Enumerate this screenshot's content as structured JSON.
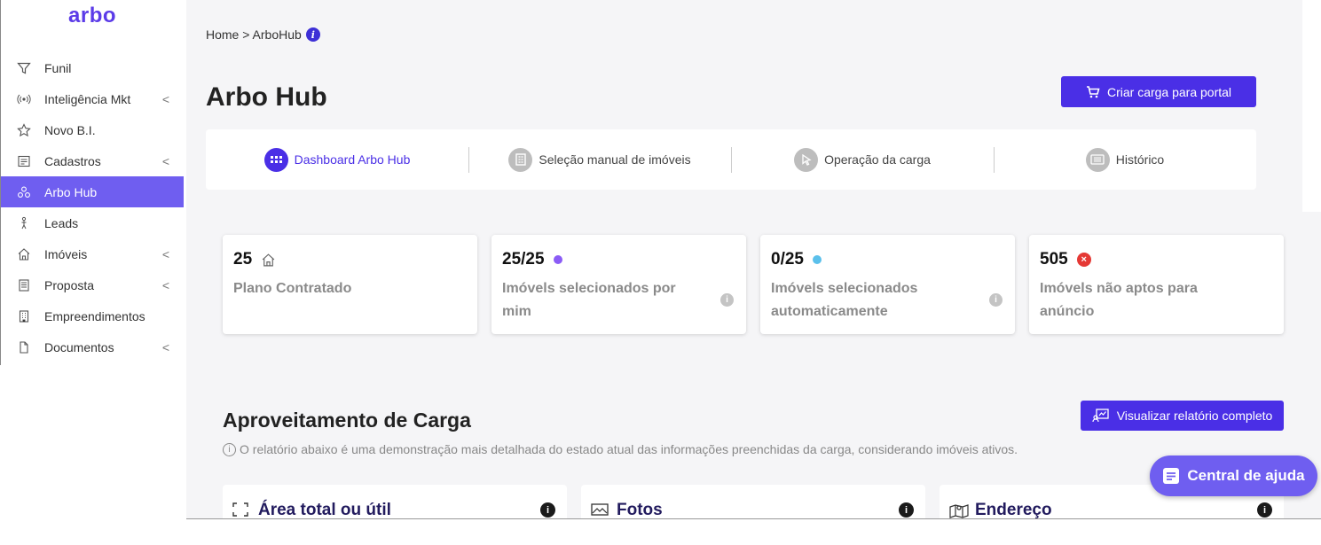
{
  "app": {
    "logo": "arbo"
  },
  "sidebar": {
    "items": [
      {
        "label": "Funil",
        "icon": "filter-icon",
        "chevron": false,
        "active": false
      },
      {
        "label": "Inteligência Mkt",
        "icon": "broadcast-icon",
        "chevron": true,
        "active": false
      },
      {
        "label": "Novo B.I.",
        "icon": "star-icon",
        "chevron": false,
        "active": false
      },
      {
        "label": "Cadastros",
        "icon": "register-icon",
        "chevron": true,
        "active": false
      },
      {
        "label": "Arbo Hub",
        "icon": "hub-icon",
        "chevron": false,
        "active": true
      },
      {
        "label": "Leads",
        "icon": "person-icon",
        "chevron": false,
        "active": false
      },
      {
        "label": "Imóveis",
        "icon": "house-icon",
        "chevron": true,
        "active": false
      },
      {
        "label": "Proposta",
        "icon": "document-icon",
        "chevron": true,
        "active": false
      },
      {
        "label": "Empreendimentos",
        "icon": "building-icon",
        "chevron": false,
        "active": false
      },
      {
        "label": "Documentos",
        "icon": "file-icon",
        "chevron": true,
        "active": false
      }
    ],
    "chevron_glyph": "<"
  },
  "breadcrumb": {
    "text": "Home > ArboHub",
    "info_glyph": "i"
  },
  "page": {
    "title": "Arbo Hub"
  },
  "toolbar": {
    "create_load_label": "Criar carga para portal"
  },
  "tabs": [
    {
      "label": "Dashboard Arbo Hub",
      "icon": "dashboard-icon",
      "active": true
    },
    {
      "label": "Seleção manual de imóveis",
      "icon": "selection-icon",
      "active": false
    },
    {
      "label": "Operação da carga",
      "icon": "cursor-icon",
      "active": false
    },
    {
      "label": "Histórico",
      "icon": "history-icon",
      "active": false
    }
  ],
  "stats": [
    {
      "value": "25",
      "label": "Plano Contratado",
      "marker": "house-icon",
      "info": false
    },
    {
      "value": "25/25",
      "label": "Imóvels selecionados por mim",
      "marker": "purple-dot",
      "marker_color": "#8b5cf6",
      "info": true
    },
    {
      "value": "0/25",
      "label": "Imóvels selecionados automaticamente",
      "marker": "blue-dot",
      "marker_color": "#5bc0eb",
      "info": true
    },
    {
      "value": "505",
      "label": "Imóvels não aptos para anúncio",
      "marker": "error-icon",
      "marker_color": "#e53935",
      "info": false
    }
  ],
  "report_section": {
    "title": "Aproveitamento de Carga",
    "description": "O relatório abaixo é uma demonstração mais detalhada do estado atual das informações preenchidas da carga, considerando imóveis ativos.",
    "button_label": "Visualizar relatório completo"
  },
  "cards": [
    {
      "title": "Área total ou útil",
      "icon": "expand-icon"
    },
    {
      "title": "Fotos",
      "icon": "photo-icon"
    },
    {
      "title": "Endereço",
      "icon": "map-icon"
    }
  ],
  "help": {
    "label": "Central de ajuda"
  },
  "colors": {
    "brand": "#4a2fe6",
    "sidebar_active": "#6f5ef0",
    "background": "#f5f5f7"
  }
}
